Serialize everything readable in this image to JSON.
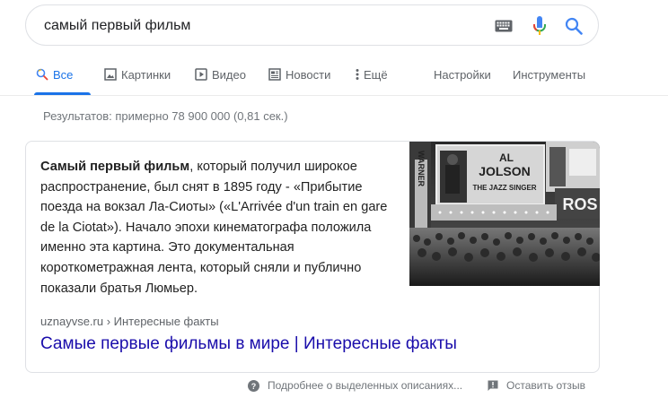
{
  "search": {
    "query": "самый первый фильм",
    "keyboard_icon": "keyboard-icon",
    "mic_icon": "microphone-icon",
    "search_icon": "search-icon"
  },
  "tabs": {
    "all": "Все",
    "images": "Картинки",
    "video": "Видео",
    "news": "Новости",
    "more": "Ещё",
    "settings": "Настройки",
    "tools": "Инструменты"
  },
  "stats": "Результатов: примерно 78 900 000 (0,81 сек.)",
  "snippet": {
    "bold": "Самый первый фильм",
    "text": ", который получил широкое распространение, был снят в 1895 году - «Прибытие поезда на вокзал Ла-Сиоты» («L'Arrivée d'un train en gare de la Ciotat»). Начало эпохи кинематографа положила именно эта картина. Это документальная короткометражная лента, который сняли и публично показали братья Люмьер.",
    "image_texts": {
      "marquee_top": "AL",
      "name": "JOLSON",
      "show": "THE JAZZ SINGER",
      "left_sign": "WARNER",
      "right_sign": "ROS"
    },
    "cite": "uznayvse.ru › Интересные факты",
    "link_title": "Самые первые фильмы в мире | Интересные факты"
  },
  "footer": {
    "about": "Подробнее о выделенных описаниях...",
    "feedback": "Оставить отзыв",
    "help_icon": "help-circle-icon",
    "feedback_icon": "feedback-flag-icon"
  },
  "colors": {
    "accent": "#1a73e8",
    "link": "#1a0dab",
    "muted": "#70757a"
  }
}
